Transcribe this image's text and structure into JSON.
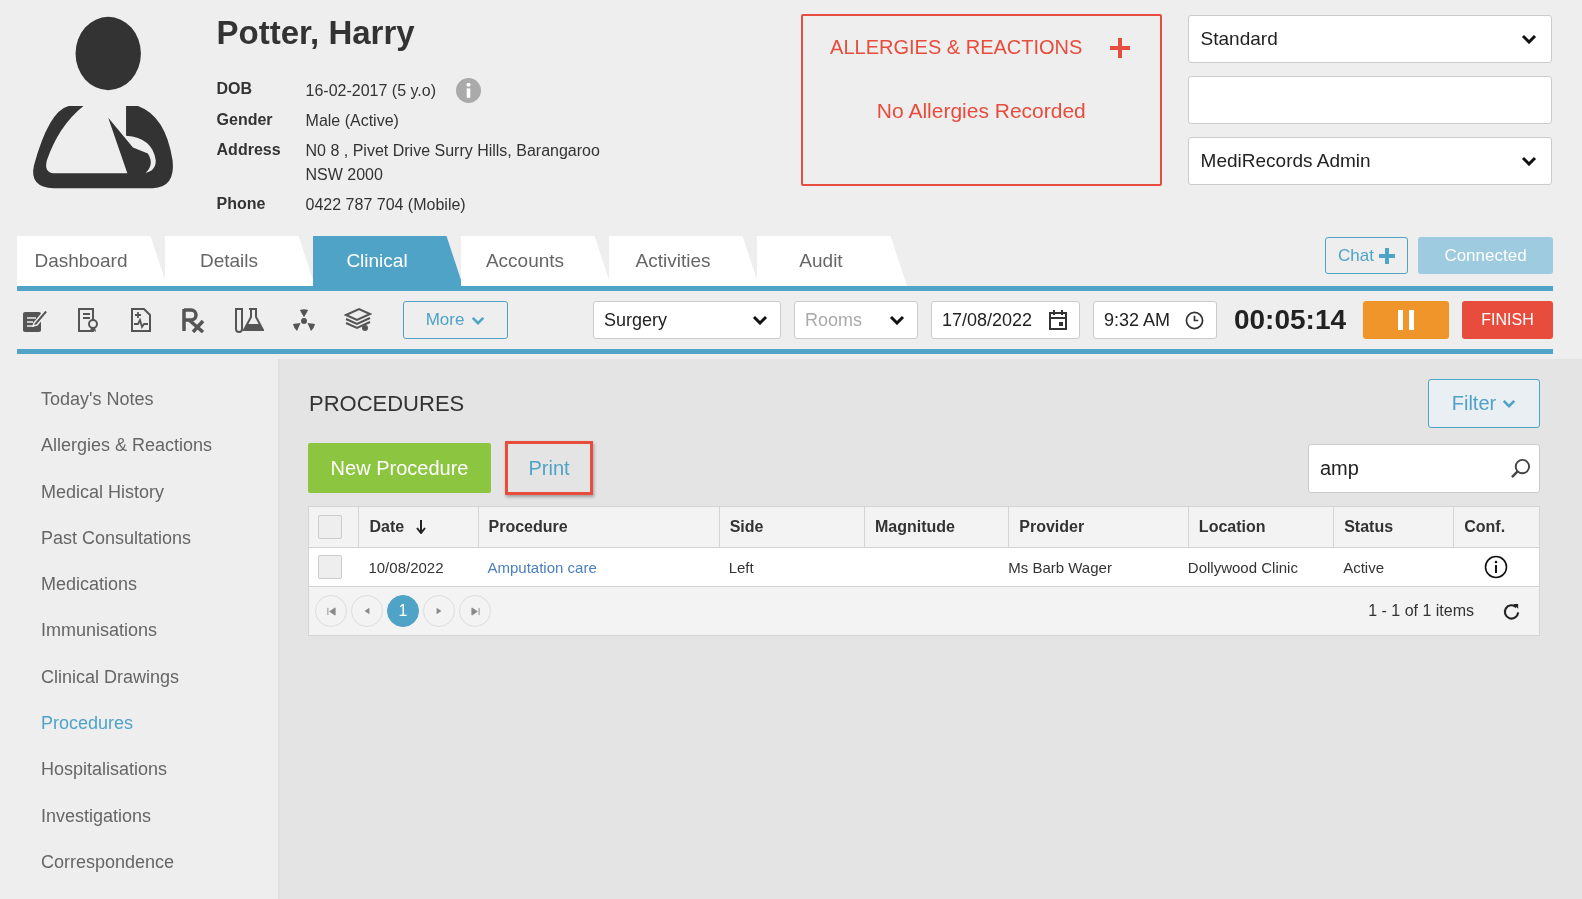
{
  "patient": {
    "name": "Potter, Harry",
    "fields": [
      {
        "label": "DOB",
        "lines": [
          "16-02-2017 (5 y.o)"
        ],
        "info": true
      },
      {
        "label": "Gender",
        "lines": [
          "Male (Active)"
        ],
        "info": false
      },
      {
        "label": "Address",
        "lines": [
          "N0 8 , Pivet Drive Surry Hills, Barangaroo",
          "NSW 2000"
        ],
        "info": false
      },
      {
        "label": "Phone",
        "lines": [
          "0422 787 704 (Mobile)"
        ],
        "info": false
      }
    ]
  },
  "allergies": {
    "title": "ALLERGIES & REACTIONS",
    "message": "No Allergies Recorded"
  },
  "selectors": [
    {
      "kind": "select",
      "value": "Standard"
    },
    {
      "kind": "input"
    },
    {
      "kind": "select",
      "value": "MediRecords Admin"
    }
  ],
  "tabs": [
    {
      "label": "Dashboard",
      "selected": false
    },
    {
      "label": "Details",
      "selected": false
    },
    {
      "label": "Clinical",
      "selected": true
    },
    {
      "label": "Accounts",
      "selected": false
    },
    {
      "label": "Activities",
      "selected": false
    },
    {
      "label": "Audit",
      "selected": false
    }
  ],
  "chat": "Chat",
  "connection": "Connected",
  "toolbar": {
    "more": "More",
    "location": "Surgery",
    "rooms_placeholder": "Rooms",
    "date": "17/08/2022",
    "time": "9:32 AM",
    "timer": "00:05:14",
    "finish": "FINISH"
  },
  "sidebar": {
    "items": [
      {
        "label": "Today's Notes",
        "selected": false
      },
      {
        "label": "Allergies & Reactions",
        "selected": false
      },
      {
        "label": "Medical History",
        "selected": false
      },
      {
        "label": "Past Consultations",
        "selected": false
      },
      {
        "label": "Medications",
        "selected": false
      },
      {
        "label": "Immunisations",
        "selected": false
      },
      {
        "label": "Clinical Drawings",
        "selected": false
      },
      {
        "label": "Procedures",
        "selected": true
      },
      {
        "label": "Hospitalisations",
        "selected": false
      },
      {
        "label": "Investigations",
        "selected": false
      },
      {
        "label": "Correspondence",
        "selected": false
      }
    ]
  },
  "section": {
    "title": "PROCEDURES",
    "filter": "Filter",
    "new_button": "New Procedure",
    "print_button": "Print",
    "print_highlighted": true,
    "search_value": "amp"
  },
  "table": {
    "columns": [
      {
        "label": "Date",
        "sorted": true
      },
      {
        "label": "Procedure",
        "sorted": false
      },
      {
        "label": "Side",
        "sorted": false
      },
      {
        "label": "Magnitude",
        "sorted": false
      },
      {
        "label": "Provider",
        "sorted": false
      },
      {
        "label": "Location",
        "sorted": false
      },
      {
        "label": "Status",
        "sorted": false
      },
      {
        "label": "Conf.",
        "sorted": false
      }
    ],
    "header_checked": false,
    "rows": [
      {
        "checked": false,
        "date": "10/08/2022",
        "procedure": "Amputation care",
        "side": "Left",
        "provider": "Ms Barb Wager",
        "location": "Dollywood Clinic",
        "status": "Active"
      }
    ]
  },
  "pagination": {
    "pages": [
      {
        "label": "1",
        "selected": true
      }
    ],
    "summary": "1 - 1 of 1 items"
  }
}
